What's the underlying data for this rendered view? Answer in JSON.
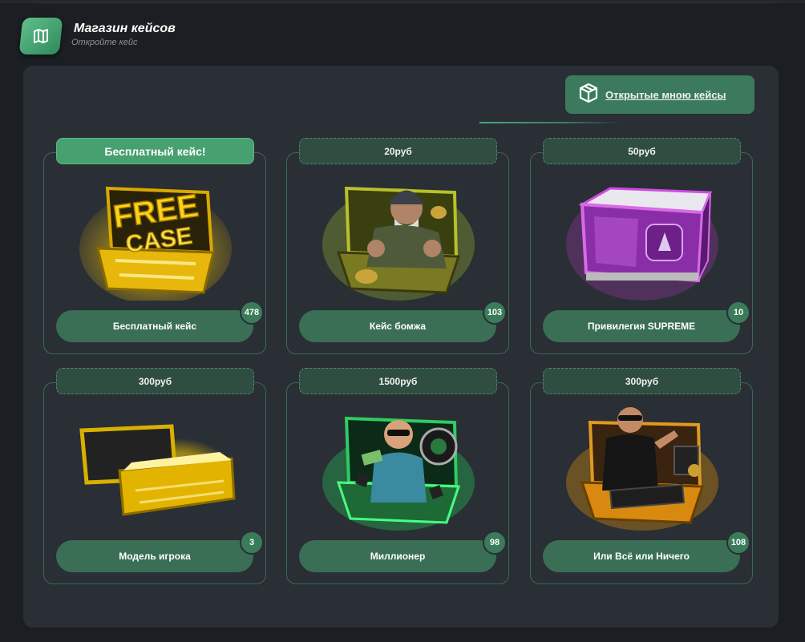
{
  "header": {
    "title": "Магазин кейсов",
    "subtitle": "Откройте кейс",
    "icon": "map-icon"
  },
  "opened_cases_button": {
    "label": "Открытые мною кейсы",
    "icon": "box-icon"
  },
  "cases": [
    {
      "price_label": "Бесплатный кейс!",
      "name": "Бесплатный кейс",
      "count": "478",
      "image": "free-case-art",
      "free": true
    },
    {
      "price_label": "20руб",
      "name": "Кейс бомжа",
      "count": "103",
      "image": "homeless-case-art"
    },
    {
      "price_label": "50руб",
      "name": "Привилегия SUPREME",
      "count": "10",
      "image": "supreme-case-art"
    },
    {
      "price_label": "300руб",
      "name": "Модель игрока",
      "count": "3",
      "image": "player-model-case-art"
    },
    {
      "price_label": "1500руб",
      "name": "Миллионер",
      "count": "98",
      "image": "millionaire-case-art"
    },
    {
      "price_label": "300руб",
      "name": "Или Всё или Ничего",
      "count": "108",
      "image": "all-or-nothing-case-art"
    }
  ],
  "free_case_art_text": "FREE CASE",
  "colors": {
    "accent": "#46a06f",
    "button": "#3a6f55",
    "panel": "#2a2e35",
    "background": "#1b1e22"
  }
}
